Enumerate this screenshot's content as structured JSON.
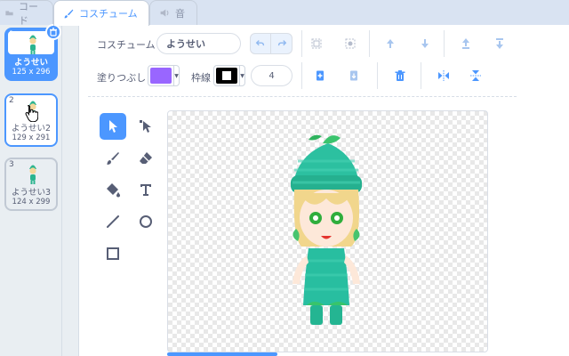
{
  "tabs": [
    {
      "label": "コード",
      "icon": "code-icon"
    },
    {
      "label": "コスチューム",
      "icon": "brush-icon"
    },
    {
      "label": "音",
      "icon": "speaker-icon"
    }
  ],
  "costumes": [
    {
      "number": "1",
      "name": "ようせい",
      "size": "125 x 296",
      "state": "selected"
    },
    {
      "number": "2",
      "name": "ようせい2",
      "size": "129 x 291",
      "state": "hovered"
    },
    {
      "number": "3",
      "name": "ようせい3",
      "size": "124 x 299",
      "state": "normal"
    }
  ],
  "editor": {
    "costume_label": "コスチューム",
    "costume_name": "ようせい",
    "fill_label": "塗りつぶし",
    "fill_color": "#9966ff",
    "outline_label": "枠線",
    "outline_color": "#000000",
    "outline_width": "4"
  },
  "colors": {
    "accent": "#4c97ff",
    "text": "#575e75"
  }
}
